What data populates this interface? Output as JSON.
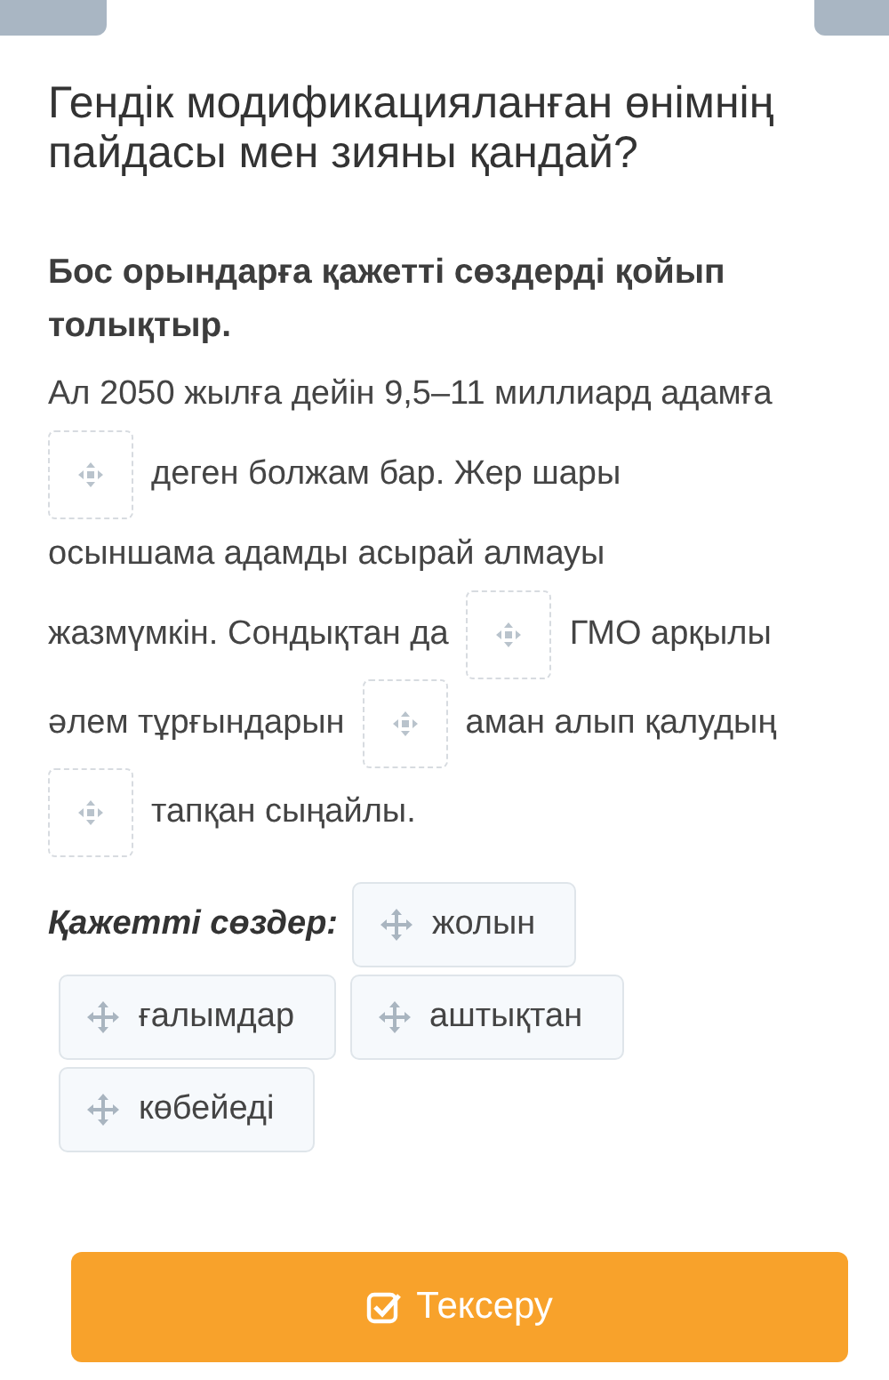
{
  "question": {
    "title": "Гендік модификацияланған өнімнің пайдасы мен зияны қандай?"
  },
  "instruction": "Бос орындарға қажетті сөздерді қойып толықтыр.",
  "passage": [
    [
      {
        "kind": "text",
        "text": "Ал 2050 жылға дейін 9,5–11 миллиард адамға"
      }
    ],
    [
      {
        "kind": "blank"
      },
      {
        "kind": "text",
        "text": "деген болжам бар. Жер шары"
      }
    ],
    [
      {
        "kind": "text",
        "text": "осыншама адамды асырай алмауы"
      }
    ],
    [
      {
        "kind": "text",
        "text": "жазмүмкін. Сондықтан да"
      },
      {
        "kind": "blank"
      },
      {
        "kind": "text",
        "text": "ГМО арқылы"
      }
    ],
    [
      {
        "kind": "text",
        "text": "әлем тұрғындарын"
      },
      {
        "kind": "blank"
      },
      {
        "kind": "text",
        "text": "аман алып қалудың"
      }
    ],
    [
      {
        "kind": "blank"
      },
      {
        "kind": "text",
        "text": "тапқан сыңайлы."
      }
    ]
  ],
  "word_bank": {
    "label": "Қажетті сөздер:",
    "words": [
      "жолын",
      "ғалымдар",
      "аштықтан",
      "көбейеді"
    ]
  },
  "check_button": "Тексеру"
}
